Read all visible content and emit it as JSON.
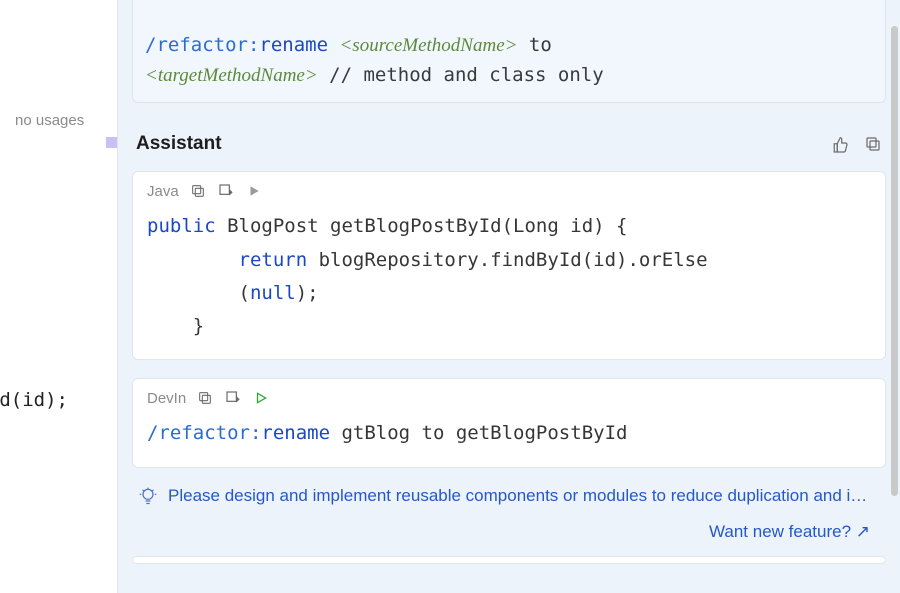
{
  "gutter": {
    "top_fragment": ");",
    "no_usages": "no usages",
    "byid_fragment": "ById(id);"
  },
  "top_snippet": {
    "command": "/refactor:",
    "action": "rename",
    "arg1": "<sourceMethodName>",
    "to": " to ",
    "arg2": "<targetMethodName>",
    "trail": " // method and class only"
  },
  "assistant": {
    "title": "Assistant"
  },
  "card1": {
    "lang": "Java",
    "line1_kw": "public",
    "line1_rest": " BlogPost getBlogPostById(Long id) {",
    "line2_indent": "        ",
    "line2_kw": "return",
    "line2_rest": " blogRepository.findById(id).orElse",
    "line3": "        (",
    "line3_kw": "null",
    "line3_rest": ");",
    "line4": "    }"
  },
  "card2": {
    "lang": "DevIn",
    "command": "/refactor:",
    "action": "rename",
    "rest": " gtBlog to getBlogPostById"
  },
  "suggestion": "Please design and implement reusable components or modules to reduce duplication and i…",
  "footer_link": "Want new feature? ↗"
}
